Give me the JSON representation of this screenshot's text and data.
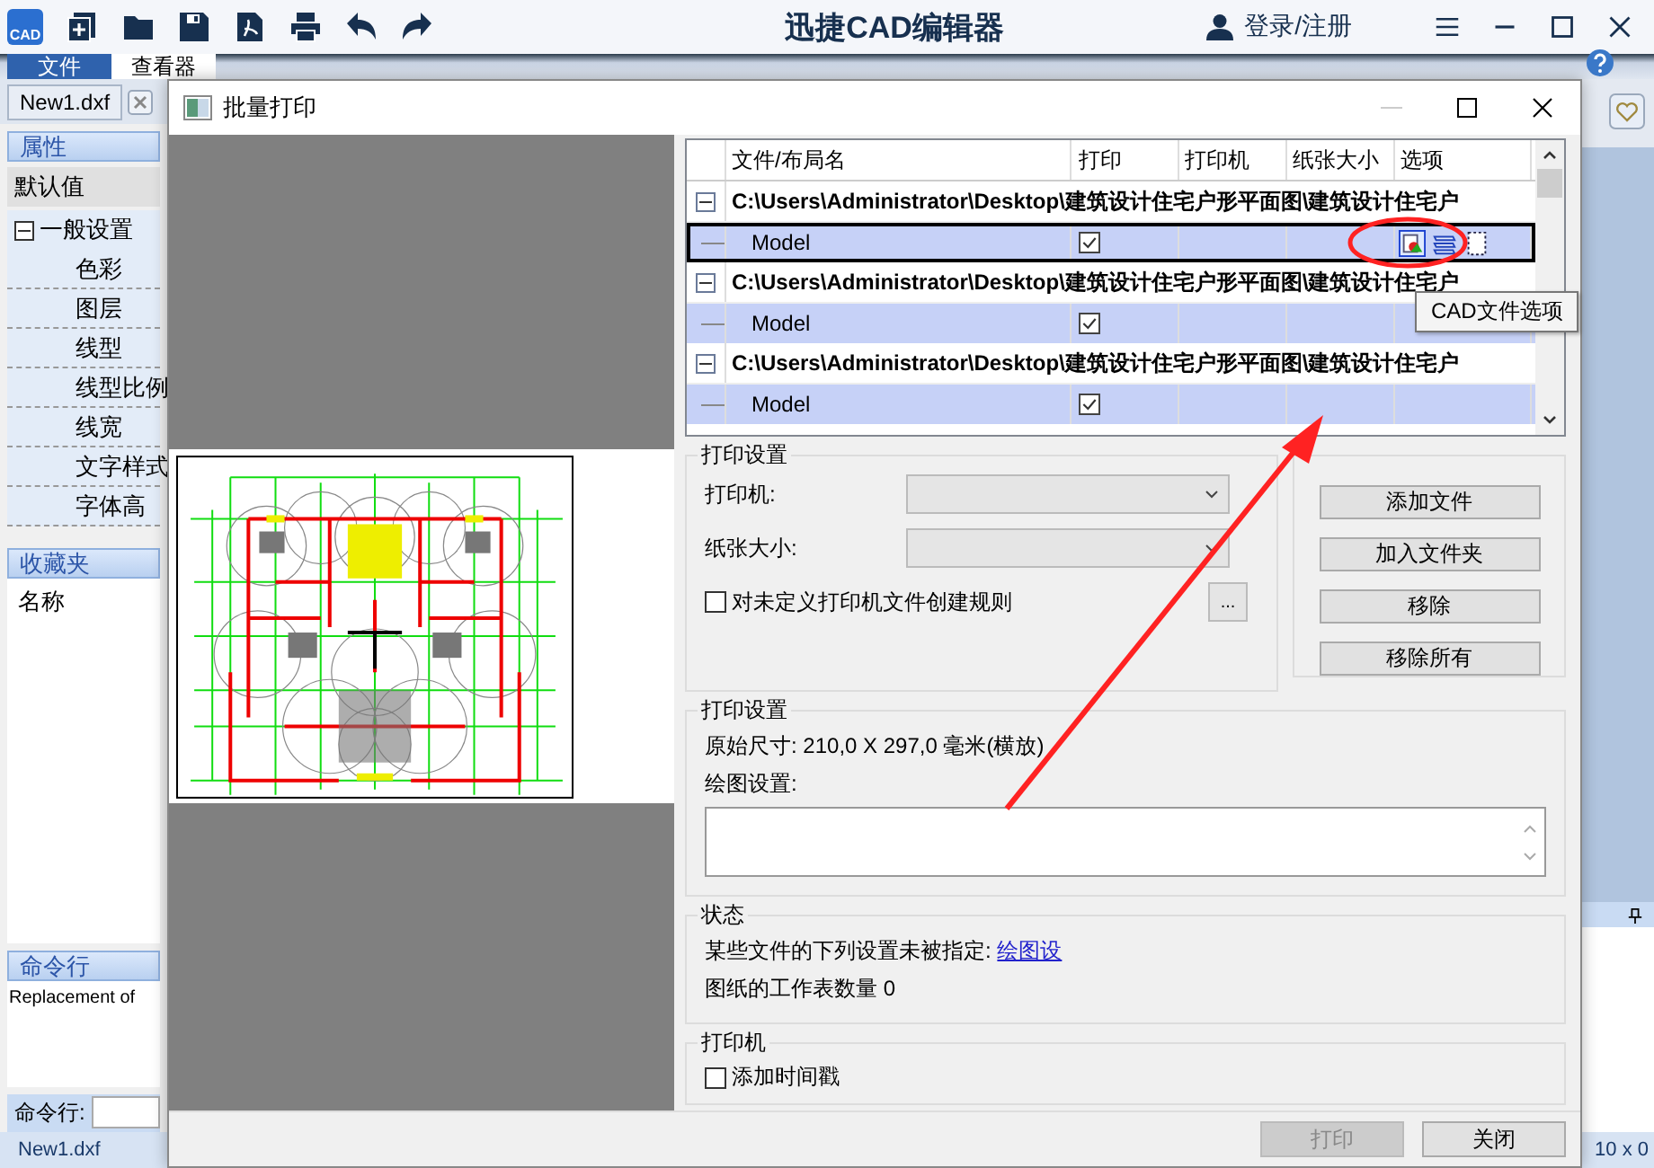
{
  "app": {
    "logo": "CAD",
    "title": "迅捷CAD编辑器",
    "account": "登录/注册"
  },
  "ribbon_tabs": [
    {
      "label": "文件",
      "kind": "menu",
      "selected": false
    },
    {
      "label": "查看器",
      "kind": "tab",
      "selected": true
    }
  ],
  "document_tab": {
    "label": "New1.dxf"
  },
  "properties_panel": {
    "title": "属性",
    "default_row": "默认值",
    "groups": [
      {
        "label": "一般设置",
        "expanded": true,
        "children": [
          {
            "label": "色彩"
          },
          {
            "label": "图层"
          },
          {
            "label": "线型"
          },
          {
            "label": "线型比例"
          },
          {
            "label": "线宽"
          },
          {
            "label": "文字样式"
          },
          {
            "label": "字体高"
          }
        ]
      }
    ]
  },
  "favorites_panel": {
    "title": "收藏夹",
    "column": "名称"
  },
  "command_panel": {
    "title": "命令行",
    "log": "Replacement of",
    "prompt": "命令行:"
  },
  "status_bar": {
    "file": "New1.dxf",
    "coords": "10 x 0"
  },
  "dialog": {
    "title": "批量打印",
    "columns": [
      "文件/布局名",
      "打印",
      "打印机",
      "纸张大小",
      "选项"
    ],
    "files": [
      {
        "path": "C:\\Users\\Administrator\\Desktop\\建筑设计住宅户形平面图\\建筑设计住宅户",
        "expanded": true,
        "children": [
          {
            "name": "Model",
            "print": true,
            "selected": true
          }
        ]
      },
      {
        "path": "C:\\Users\\Administrator\\Desktop\\建筑设计住宅户形平面图\\建筑设计住宅户",
        "expanded": true,
        "children": [
          {
            "name": "Model",
            "print": true,
            "selected": false
          }
        ]
      },
      {
        "path": "C:\\Users\\Administrator\\Desktop\\建筑设计住宅户形平面图\\建筑设计住宅户",
        "expanded": true,
        "children": [
          {
            "name": "Model",
            "print": true,
            "selected": false
          }
        ]
      }
    ],
    "tooltip": "CAD文件选项",
    "printer_group": {
      "title": "打印设置",
      "printer_label": "打印机:",
      "paper_label": "纸张大小:",
      "rule_checkbox": {
        "label": "对未定义打印机文件创建规则",
        "checked": false
      },
      "more_button": "..."
    },
    "file_buttons": [
      "添加文件",
      "加入文件夹",
      "移除",
      "移除所有"
    ],
    "settings_group": {
      "title": "打印设置",
      "original_size": "原始尺寸: 210,0 X 297,0 毫米(横放)",
      "plot_label": "绘图设置:"
    },
    "status_group": {
      "title": "状态",
      "unspecified_text": "某些文件的下列设置未被指定:",
      "unspecified_link": "绘图设",
      "sheet_count": "图纸的工作表数量 0"
    },
    "printer_options": {
      "title": "打印机",
      "timestamp_checkbox": {
        "label": "添加时间戳",
        "checked": false
      }
    },
    "footer_buttons": [
      {
        "label": "打印",
        "disabled": true
      },
      {
        "label": "关闭",
        "disabled": false
      }
    ]
  }
}
